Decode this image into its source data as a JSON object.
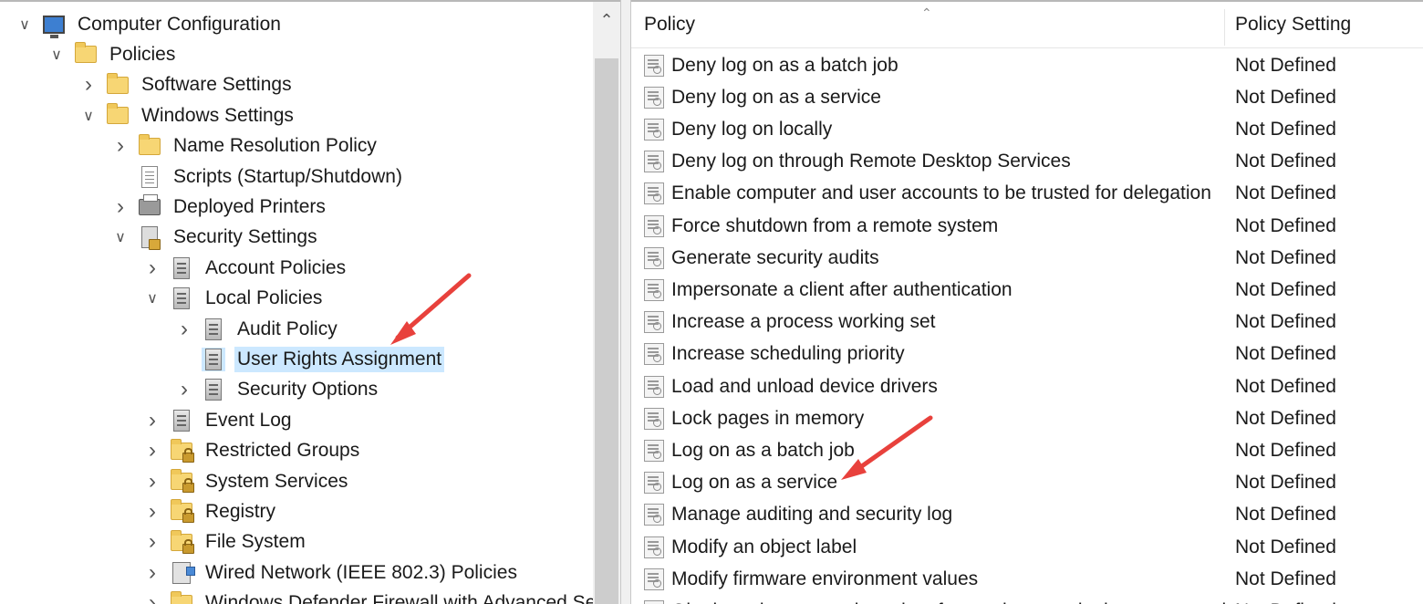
{
  "tree": {
    "scroll_up_glyph": "⌃",
    "nodes": [
      {
        "label": "Computer Configuration",
        "expander": "expanded",
        "icon": "computer-icon"
      },
      {
        "label": "Policies",
        "expander": "expanded",
        "icon": "folder-icon"
      },
      {
        "label": "Software Settings",
        "expander": "collapsed",
        "icon": "folder-icon"
      },
      {
        "label": "Windows Settings",
        "expander": "expanded",
        "icon": "folder-icon"
      },
      {
        "label": "Name Resolution Policy",
        "expander": "collapsed",
        "icon": "folder-icon"
      },
      {
        "label": "Scripts (Startup/Shutdown)",
        "expander": "none",
        "icon": "script-icon"
      },
      {
        "label": "Deployed Printers",
        "expander": "collapsed",
        "icon": "printer-icon"
      },
      {
        "label": "Security Settings",
        "expander": "expanded",
        "icon": "security-settings-icon"
      },
      {
        "label": "Account Policies",
        "expander": "collapsed",
        "icon": "policy-server-icon"
      },
      {
        "label": "Local Policies",
        "expander": "expanded",
        "icon": "policy-server-icon"
      },
      {
        "label": "Audit Policy",
        "expander": "collapsed",
        "icon": "policy-server-icon"
      },
      {
        "label": "User Rights Assignment",
        "expander": "none",
        "icon": "policy-server-icon",
        "selected": true
      },
      {
        "label": "Security Options",
        "expander": "collapsed",
        "icon": "policy-server-icon"
      },
      {
        "label": "Event Log",
        "expander": "collapsed",
        "icon": "policy-server-icon"
      },
      {
        "label": "Restricted Groups",
        "expander": "collapsed",
        "icon": "locked-folder-icon"
      },
      {
        "label": "System Services",
        "expander": "collapsed",
        "icon": "locked-folder-icon"
      },
      {
        "label": "Registry",
        "expander": "collapsed",
        "icon": "locked-folder-icon"
      },
      {
        "label": "File System",
        "expander": "collapsed",
        "icon": "locked-folder-icon"
      },
      {
        "label": "Wired Network (IEEE 802.3) Policies",
        "expander": "collapsed",
        "icon": "network-policy-icon"
      },
      {
        "label": "Windows Defender Firewall with Advanced Se",
        "expander": "collapsed",
        "icon": "folder-icon"
      }
    ]
  },
  "list": {
    "columns": {
      "policy": "Policy",
      "setting": "Policy Setting"
    },
    "sort_glyph": "⌃",
    "rows": [
      {
        "policy": "Deny log on as a batch job",
        "setting": "Not Defined"
      },
      {
        "policy": "Deny log on as a service",
        "setting": "Not Defined"
      },
      {
        "policy": "Deny log on locally",
        "setting": "Not Defined"
      },
      {
        "policy": "Deny log on through Remote Desktop Services",
        "setting": "Not Defined"
      },
      {
        "policy": "Enable computer and user accounts to be trusted for delegation",
        "setting": "Not Defined"
      },
      {
        "policy": "Force shutdown from a remote system",
        "setting": "Not Defined"
      },
      {
        "policy": "Generate security audits",
        "setting": "Not Defined"
      },
      {
        "policy": "Impersonate a client after authentication",
        "setting": "Not Defined"
      },
      {
        "policy": "Increase a process working set",
        "setting": "Not Defined"
      },
      {
        "policy": "Increase scheduling priority",
        "setting": "Not Defined"
      },
      {
        "policy": "Load and unload device drivers",
        "setting": "Not Defined"
      },
      {
        "policy": "Lock pages in memory",
        "setting": "Not Defined"
      },
      {
        "policy": "Log on as a batch job",
        "setting": "Not Defined"
      },
      {
        "policy": "Log on as a service",
        "setting": "Not Defined"
      },
      {
        "policy": "Manage auditing and security log",
        "setting": "Not Defined"
      },
      {
        "policy": "Modify an object label",
        "setting": "Not Defined"
      },
      {
        "policy": "Modify firmware environment values",
        "setting": "Not Defined"
      },
      {
        "policy": "Obtain an impersonation token for another user in the same session",
        "setting": "Not Defined"
      }
    ]
  },
  "annotations": {
    "arrow_color": "#e8413c"
  }
}
